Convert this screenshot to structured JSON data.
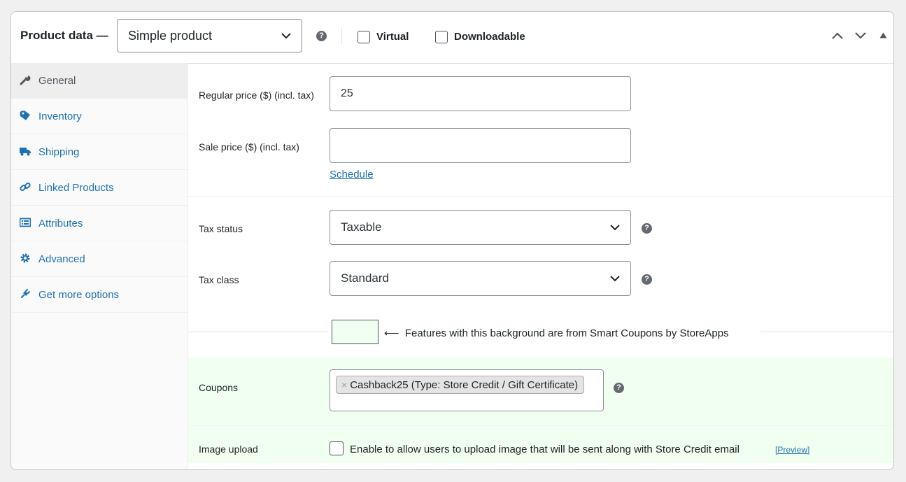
{
  "header": {
    "title": "Product data —",
    "product_type": "Simple product",
    "virtual_label": "Virtual",
    "downloadable_label": "Downloadable",
    "virtual_checked": false,
    "downloadable_checked": false
  },
  "sidebar": {
    "items": [
      {
        "label": "General",
        "icon": "wrench-icon",
        "active": true
      },
      {
        "label": "Inventory",
        "icon": "tag-icon"
      },
      {
        "label": "Shipping",
        "icon": "truck-icon"
      },
      {
        "label": "Linked Products",
        "icon": "link-icon"
      },
      {
        "label": "Attributes",
        "icon": "list-icon"
      },
      {
        "label": "Advanced",
        "icon": "gear-icon"
      },
      {
        "label": "Get more options",
        "icon": "plug-icon"
      }
    ]
  },
  "general": {
    "regular_price_label": "Regular price ($) (incl. tax)",
    "regular_price_value": "25",
    "sale_price_label": "Sale price ($) (incl. tax)",
    "sale_price_value": "",
    "schedule_link": "Schedule",
    "tax_status_label": "Tax status",
    "tax_status_value": "Taxable",
    "tax_class_label": "Tax class",
    "tax_class_value": "Standard",
    "smart_coupons_note": "⟵  Features with this background are from Smart Coupons by StoreApps",
    "coupons_label": "Coupons",
    "coupon_chip": "Cashback25 (Type: Store Credit / Gift Certificate)",
    "coupon_remove": "×",
    "image_upload_label": "Image upload",
    "image_upload_text": "Enable to allow users to upload image that will be sent along with Store Credit email",
    "preview_link": "[Preview]",
    "image_upload_checked": false
  },
  "help_glyph": "?",
  "colors": {
    "accent": "#2271b1",
    "smart_coupons_bg": "#f0fff0"
  }
}
